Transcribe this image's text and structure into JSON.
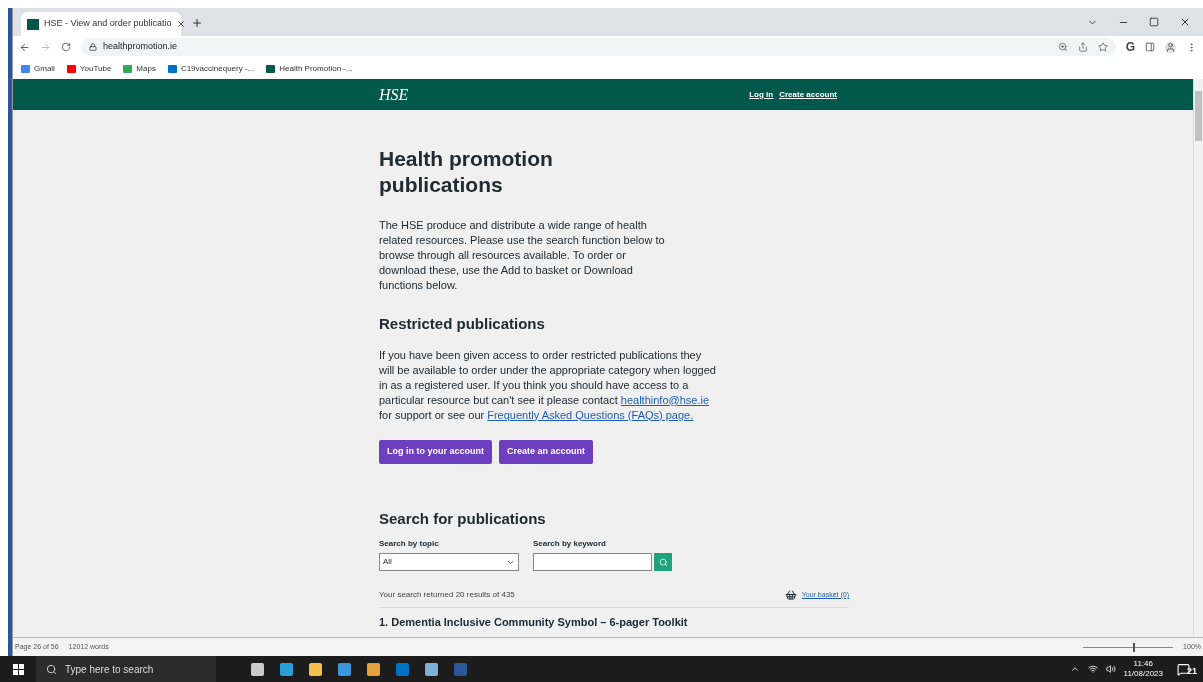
{
  "browser": {
    "tab": {
      "title": "HSE - View and order publicatio",
      "selected": true
    },
    "url": "healthpromotion.ie",
    "extension": "G",
    "bookmarks": [
      {
        "label": "Gmail",
        "kind": "google"
      },
      {
        "label": "YouTube",
        "kind": "youtube"
      },
      {
        "label": "Maps",
        "kind": "maps"
      },
      {
        "label": "C19vaccinequery -...",
        "kind": "outlook"
      },
      {
        "label": "Health Promotion -...",
        "kind": "hse"
      }
    ]
  },
  "site_header": {
    "logo": "HSE",
    "links": [
      "Log in",
      "Create account"
    ]
  },
  "main": {
    "title": "Health promotion publications",
    "intro": "The HSE produce and distribute a wide range of health related resources. Please use the search function below to browse through all resources available. To order or download these, use the Add to basket or Download functions below.",
    "restricted": {
      "heading": "Restricted publications",
      "text_before": "If you have been given access to order restricted publications they will be available to order under the appropriate category when logged in as a registered user. If you think you should have access to a particular resource but can't see it please contact ",
      "email": "healthinfo@hse.ie",
      "text_middle": " for support or see our ",
      "faq_link": "Frequently Asked Questions (FAQs) page.",
      "buttons": [
        "Log in to your account",
        "Create an account"
      ]
    },
    "search": {
      "heading": "Search for publications",
      "topic_label": "Search by topic",
      "topic_value": "All",
      "keyword_label": "Search by keyword",
      "results": "Your search returned 20 results of 435",
      "basket": "Your basket (0)",
      "first_result": "1. Dementia Inclusive Community Symbol – 6-pager Toolkit"
    }
  },
  "word_status": {
    "page": "Page 26 of 56",
    "words": "12012 words",
    "zoom": "100%",
    "level": 0.55
  },
  "taskbar": {
    "search_placeholder": "Type here to search",
    "time": "11:46",
    "date": "11/08/2023",
    "notifications": "21"
  }
}
